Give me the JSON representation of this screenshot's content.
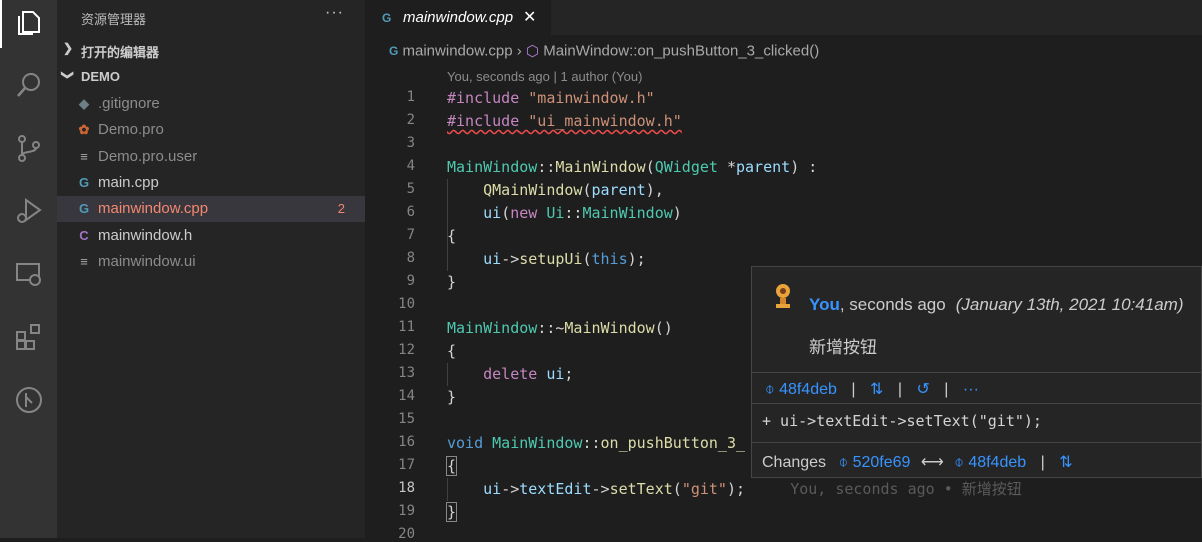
{
  "activity_bar": {
    "items": [
      "files-icon",
      "search-icon",
      "source-control-icon",
      "run-debug-icon",
      "remote-explorer-icon",
      "extensions-icon",
      "git-graph-icon"
    ]
  },
  "sidebar": {
    "title": "资源管理器",
    "more": "···",
    "open_editors": "打开的编辑器",
    "folder": "DEMO",
    "files": [
      {
        "name": ".gitignore",
        "icon": "◆",
        "color": "#6d8086",
        "badge": ""
      },
      {
        "name": "Demo.pro",
        "icon": "✿",
        "color": "#cc6633",
        "badge": ""
      },
      {
        "name": "Demo.pro.user",
        "icon": "≡",
        "color": "#a9a9a9",
        "badge": ""
      },
      {
        "name": "main.cpp",
        "icon": "G",
        "color": "#519aba",
        "badge": ""
      },
      {
        "name": "mainwindow.cpp",
        "icon": "G",
        "color": "#519aba",
        "badge": "2"
      },
      {
        "name": "mainwindow.h",
        "icon": "C",
        "color": "#a074c4",
        "badge": ""
      },
      {
        "name": "mainwindow.ui",
        "icon": "≡",
        "color": "#a9a9a9",
        "badge": ""
      }
    ]
  },
  "editor": {
    "tab": {
      "label": "mainwindow.cpp",
      "close": "✕"
    },
    "breadcrumb": {
      "file": "mainwindow.cpp",
      "sep": "›",
      "symbol": "MainWindow::on_pushButton_3_clicked()"
    },
    "blame_header": "You, seconds ago | 1 author (You)",
    "line_numbers": [
      "1",
      "2",
      "3",
      "4",
      "5",
      "6",
      "7",
      "8",
      "9",
      "10",
      "11",
      "12",
      "13",
      "14",
      "15",
      "16",
      "17",
      "18",
      "19",
      "20"
    ],
    "inline_blame": "You, seconds ago • 新增按钮"
  },
  "hover": {
    "author": "You",
    "when": ", seconds ago",
    "date": "(January 13th, 2021 10:41am)",
    "message": "新增按钮",
    "commit": "48f4deb",
    "actions_more": "···",
    "diff_line": "+ ui->textEdit->setText(\"git\");",
    "changes_label": "Changes",
    "from_commit": "520fe69",
    "arrow": "⟷",
    "to_commit": "48f4deb"
  },
  "colors": {
    "accent": "#3794ff",
    "error": "#f48771"
  }
}
